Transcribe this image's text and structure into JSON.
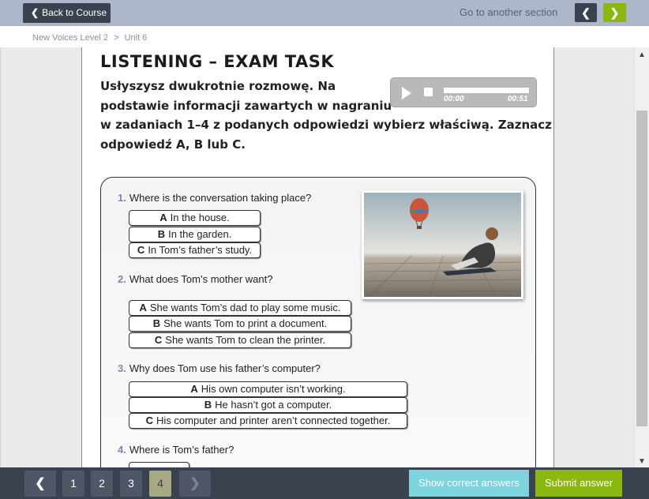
{
  "topbar": {
    "back_label": "Back to Course",
    "goto_label": "Go to another section"
  },
  "breadcrumb": [
    "New Voices Level 2",
    ">",
    "Unit 6"
  ],
  "task": {
    "title": "LISTENING – EXAM TASK",
    "instruction_lines": [
      "Usłyszysz dwukrotnie rozmowę. Na",
      "podstawie informacji zawartych w nagraniu",
      "w zadaniach 1–4 z podanych odpowiedzi wybierz właściwą. Zaznacz",
      "odpowiedź A, B lub C."
    ]
  },
  "audio": {
    "current": "00:00",
    "total": "00:51",
    "progress": 0
  },
  "questions": [
    {
      "num": "1.",
      "text": "Where is the conversation taking place?",
      "options": [
        {
          "letter": "A",
          "text": "In the house."
        },
        {
          "letter": "B",
          "text": "In the garden."
        },
        {
          "letter": "C",
          "text": "In Tom’s father’s study."
        }
      ]
    },
    {
      "num": "2.",
      "text": "What does Tom’s mother want?",
      "options": [
        {
          "letter": "A",
          "text": "She wants Tom’s dad to play some music."
        },
        {
          "letter": "B",
          "text": "She wants Tom to print a document."
        },
        {
          "letter": "C",
          "text": "She wants Tom to clean the printer."
        }
      ]
    },
    {
      "num": "3.",
      "text": "Why does Tom use his father’s computer?",
      "options": [
        {
          "letter": "A",
          "text": "His own computer isn’t working."
        },
        {
          "letter": "B",
          "text": "He hasn’t got a computer."
        },
        {
          "letter": "C",
          "text": "His computer and printer aren’t connected together."
        }
      ]
    },
    {
      "num": "4.",
      "text": "Where is Tom’s father?",
      "options": []
    }
  ],
  "pagination": {
    "pages": [
      "1",
      "2",
      "3",
      "4"
    ],
    "current": "4"
  },
  "buttons": {
    "show_answers": "Show correct answers",
    "submit": "Submit answer"
  },
  "colors": {
    "accent_green": "#8ab810",
    "dark": "#3a414f",
    "cyan": "#7fd3dd",
    "question_num": "#8a7fb4"
  }
}
